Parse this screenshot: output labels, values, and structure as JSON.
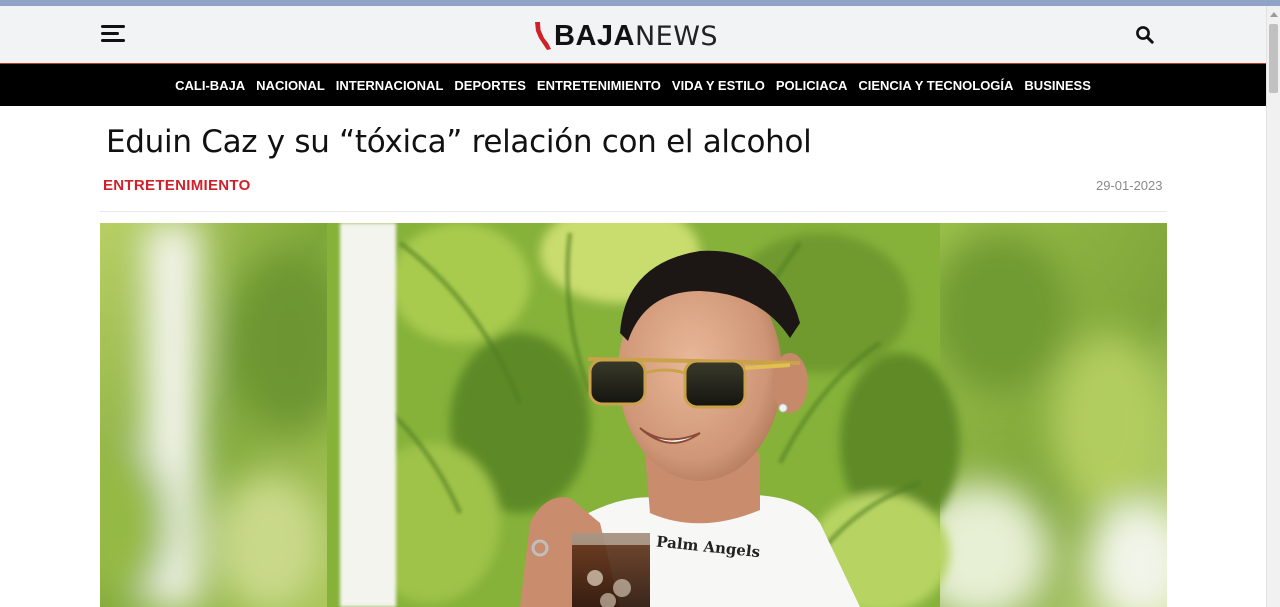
{
  "header": {
    "logo_bold": "BAJA",
    "logo_light": "NEWS",
    "menu_icon": "hamburger-menu-icon",
    "search_icon": "search-icon"
  },
  "nav": {
    "items": [
      "CALI-BAJA",
      "NACIONAL",
      "INTERNACIONAL",
      "DEPORTES",
      "ENTRETENIMIENTO",
      "VIDA Y ESTILO",
      "POLICIACA",
      "CIENCIA Y TECNOLOGÍA",
      "BUSINESS"
    ]
  },
  "article": {
    "title": "Eduin Caz y su “tóxica” relación con el alcohol",
    "category": "ENTRETENIMIENTO",
    "date": "29-01-2023",
    "shirt_text": "Palm Angels"
  },
  "colors": {
    "accent": "#d0212b",
    "navbar_bg": "#000000",
    "header_bg": "#f2f3f5",
    "foliage": "#8ab83a"
  }
}
